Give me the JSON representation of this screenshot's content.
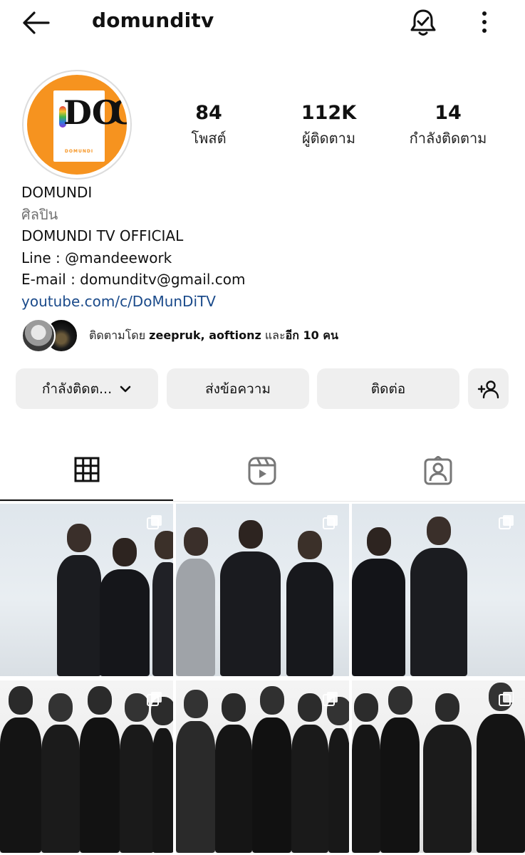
{
  "topbar": {
    "username": "domunditv",
    "back_icon": "arrow-left-icon",
    "bell_icon": "notification-bell-check-icon",
    "more_icon": "more-vertical-icon"
  },
  "profile": {
    "avatar_glyph": "DꝎ",
    "avatar_caption": "DOMUNDI",
    "avatar_bg": "#f6931f",
    "stats": {
      "posts_count": "84",
      "posts_label": "โพสต์",
      "followers_count": "112K",
      "followers_label": "ผู้ติดตาม",
      "following_count": "14",
      "following_label": "กำลังติดตาม"
    },
    "bio": {
      "name": "DOMUNDI",
      "category": "ศิลปิน",
      "line1": "DOMUNDI TV OFFICIAL",
      "line2": "Line : @mandeework",
      "line3": "E-mail : domunditv@gmail.com",
      "link": "youtube.com/c/DoMunDiTV",
      "link_color": "#1a4a8a"
    },
    "mutual": {
      "prefix": "ติดตามโดย ",
      "names": "zeepruk, aoftionz",
      "and": " และ",
      "others": "อีก 10 คน"
    }
  },
  "actions": {
    "following_label": "กำลังติดต...",
    "message_label": "ส่งข้อความ",
    "contact_label": "ติดต่อ",
    "add_user_icon": "add-user-icon"
  },
  "tabs": [
    {
      "name": "posts",
      "icon": "grid-icon",
      "active": true
    },
    {
      "name": "reels",
      "icon": "reels-icon",
      "active": false
    },
    {
      "name": "tagged",
      "icon": "tagged-person-icon",
      "active": false
    }
  ],
  "grid": {
    "tiles": 6,
    "multi_icon": "multiple-images-icon"
  }
}
